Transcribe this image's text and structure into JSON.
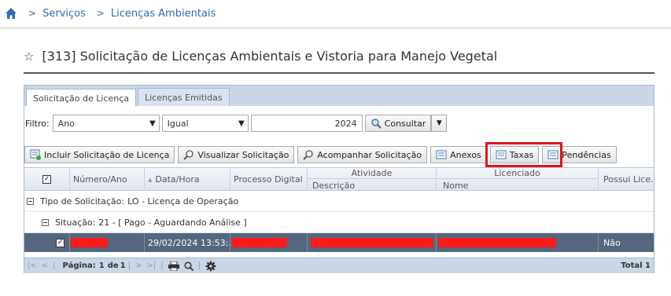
{
  "breadcrumb": {
    "items": [
      "Serviços",
      "Licenças Ambientais"
    ]
  },
  "page": {
    "title": "[313] Solicitação de Licenças Ambientais e Vistoria para Manejo Vegetal"
  },
  "tabs": [
    "Solicitação de Licença",
    "Licenças Emitidas"
  ],
  "filter": {
    "label": "Filtro:",
    "field": "Ano",
    "operator": "Igual",
    "value": "2024",
    "consult_label": "Consultar"
  },
  "toolbar": {
    "include": "Incluir Solicitação de Licença",
    "view": "Visualizar Solicitação",
    "track": "Acompanhar Solicitação",
    "attachments": "Anexos",
    "fees": "Taxas",
    "pending": "Pendências"
  },
  "grid": {
    "headers": {
      "numero": "Número/Ano",
      "data": "Data/Hora",
      "processo": "Processo Digital",
      "atividade": "Atividade",
      "descricao": "Descrição",
      "licenciado": "Licenciado",
      "nome": "Nome",
      "possui": "Possui Lice..."
    },
    "group1": {
      "label": "Tipo de Solicitação:",
      "value": "LO - Licença de Operação"
    },
    "group2": {
      "label": "Situação:",
      "value": "21 - [ Pago - Aguardando Análise ]"
    },
    "rows": [
      {
        "data_hora": "29/02/2024 13:53:...",
        "possui": "Não"
      }
    ]
  },
  "pager": {
    "page_label": "Página:",
    "page": "1",
    "of_label": "de",
    "total_pages": "1",
    "total": "Total 1"
  },
  "colors": {
    "accent": "#2f6db5",
    "highlight": "#e0131a",
    "selected_row": "#55677e",
    "redaction": "#ff1a1a"
  }
}
